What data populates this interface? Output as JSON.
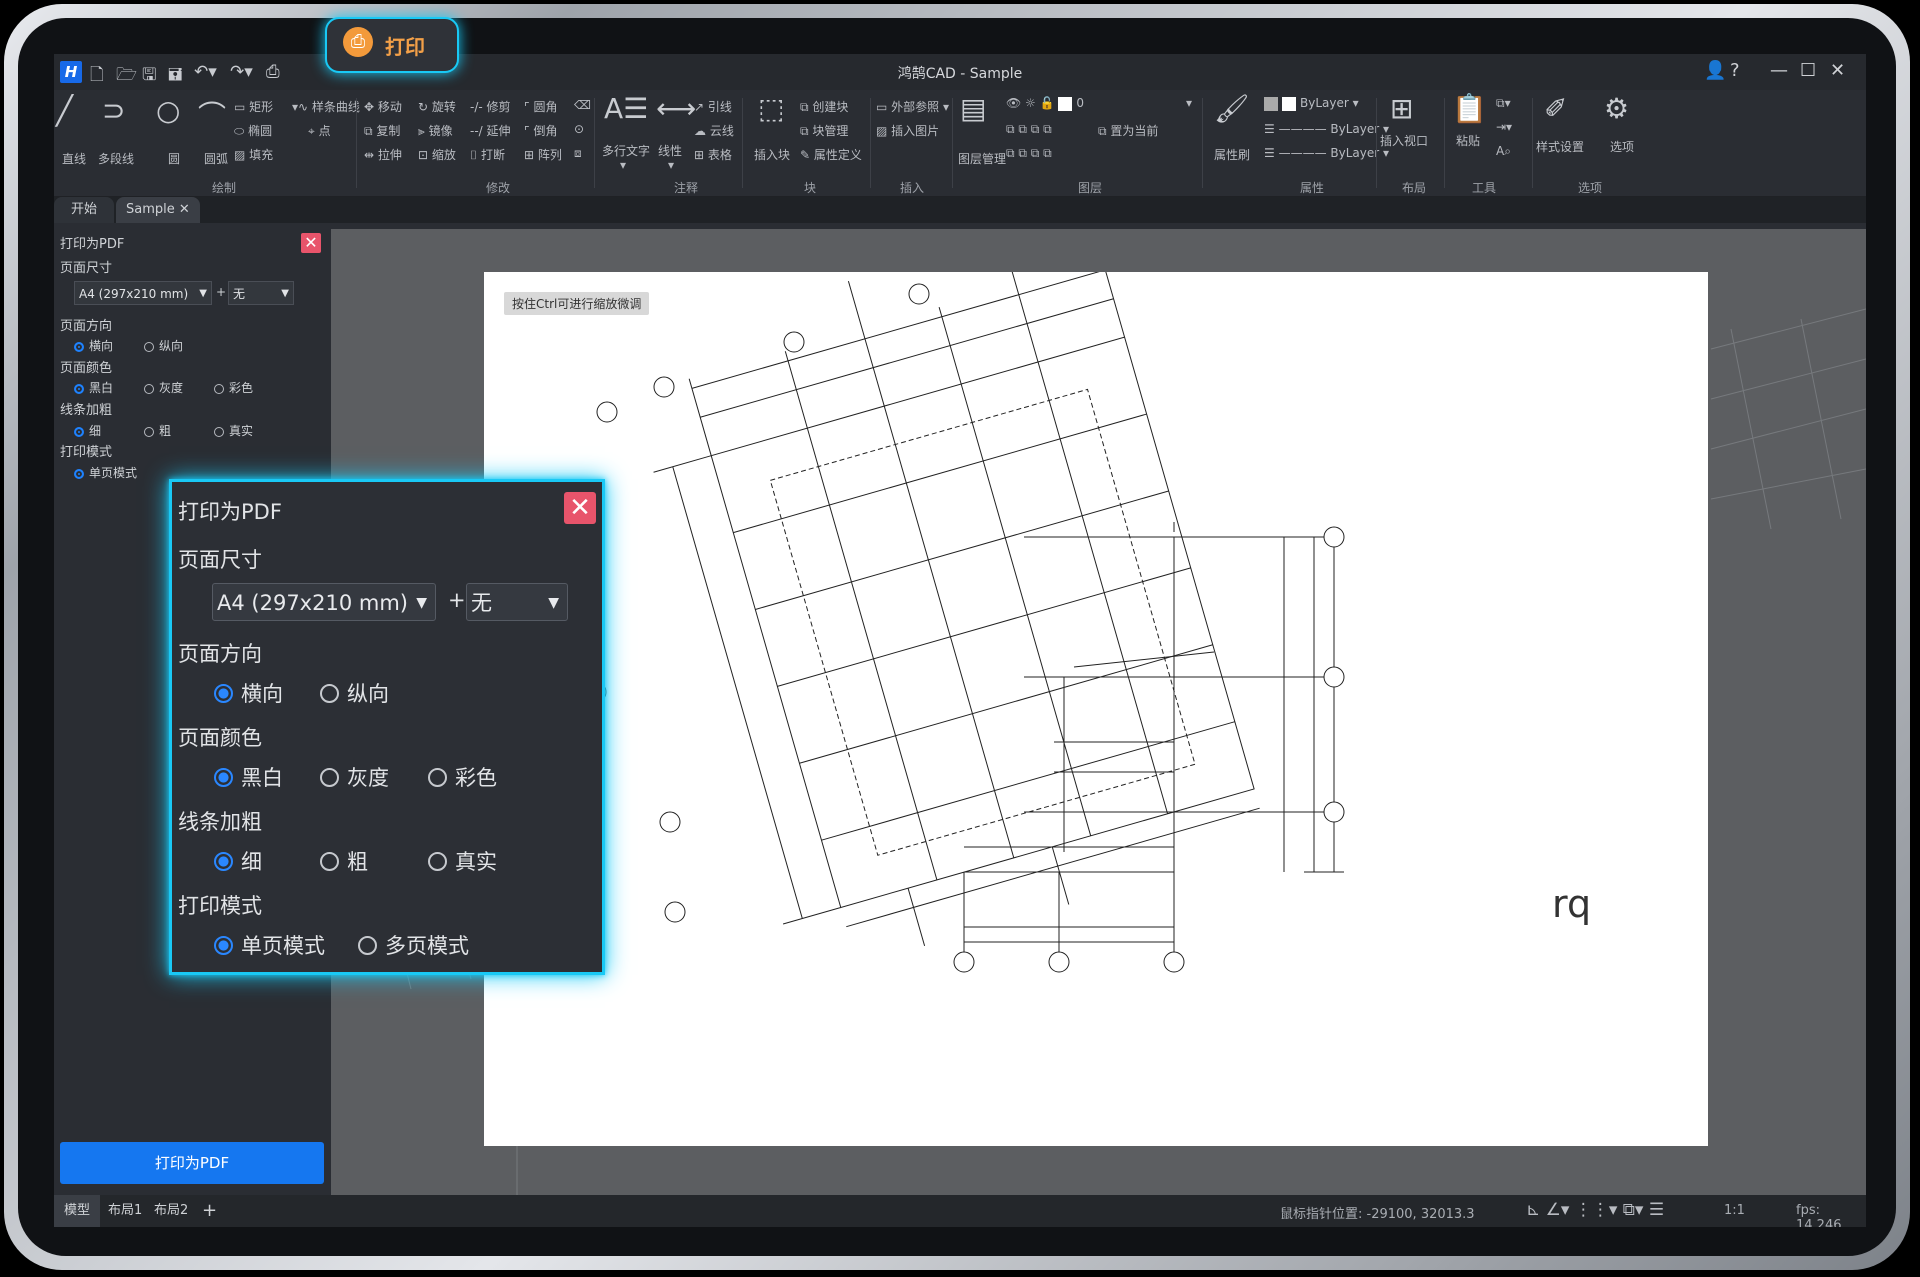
{
  "app": {
    "title": "鸿鹄CAD - Sample",
    "logo": "H"
  },
  "quick_access": {
    "icons": [
      "new-file-icon",
      "open-icon",
      "save-icon",
      "save-as-icon",
      "undo-icon",
      "redo-icon",
      "print-icon"
    ]
  },
  "ribbon": {
    "draw": {
      "section": "绘制",
      "line": "直线",
      "polyline": "多段线",
      "circle": "圆",
      "arc": "圆弧",
      "rect": "矩形",
      "ellipse": "椭圆",
      "hatch": "填充",
      "spline": "样条曲线",
      "point": "点"
    },
    "modify": {
      "section": "修改",
      "move": "移动",
      "rotate": "旋转",
      "trim": "修剪",
      "fillet": "圆角",
      "copy": "复制",
      "mirror": "镜像",
      "extend": "延伸",
      "chamfer": "倒角",
      "stretch": "拉伸",
      "scale": "缩放",
      "break": "打断",
      "array": "阵列"
    },
    "annotate": {
      "section": "注释",
      "mtext": "多行文字",
      "linear": "线性",
      "leader": "引线",
      "revcloud": "云线",
      "table": "表格"
    },
    "block": {
      "section": "块",
      "insert": "插入块",
      "create": "创建块",
      "manage": "块管理",
      "attdef": "属性定义"
    },
    "insert": {
      "section": "插入",
      "xref": "外部参照",
      "image": "插入图片"
    },
    "layer": {
      "section": "图层",
      "manager": "图层管理",
      "current_value": "0",
      "set_current": "置为当前"
    },
    "properties": {
      "section": "属性",
      "brush": "属性刷",
      "color": "ByLayer",
      "linetype": "ByLayer",
      "lineweight": "ByLayer"
    },
    "layout": {
      "section": "布局",
      "insert_viewport": "插入视口"
    },
    "tools": {
      "section": "工具",
      "paste": "粘贴"
    },
    "options": {
      "section": "选项",
      "style_settings": "样式设置",
      "options": "选项"
    }
  },
  "highlight_print": {
    "label": "打印"
  },
  "doc_tabs": [
    "开始",
    "Sample"
  ],
  "panel": {
    "title": "打印为PDF",
    "page_size_label": "页面尺寸",
    "page_size": "A4 (297x210 mm)",
    "plus": "+",
    "extra": "无",
    "orientation_label": "页面方向",
    "orientation": [
      "横向",
      "纵向"
    ],
    "color_label": "页面颜色",
    "color": [
      "黑白",
      "灰度",
      "彩色"
    ],
    "line_label": "线条加粗",
    "line": [
      "细",
      "粗",
      "真实"
    ],
    "mode_label": "打印模式",
    "mode": [
      "单页模式",
      "多页模式"
    ],
    "print_button": "打印为PDF"
  },
  "canvas": {
    "hint": "按住Ctrl可进行缩放微调",
    "rq_text": "rq"
  },
  "statusbar": {
    "tabs": [
      "模型",
      "布局1",
      "布局2"
    ],
    "add": "+",
    "coords": "鼠标指针位置: -29100, 32013.3",
    "scale": "1:1",
    "fps": "fps: 14.246"
  },
  "colors": {
    "accent": "#1577f0",
    "highlight": "#19c9f5",
    "print_orange": "#f39a3b",
    "close_red": "#e8546b"
  }
}
